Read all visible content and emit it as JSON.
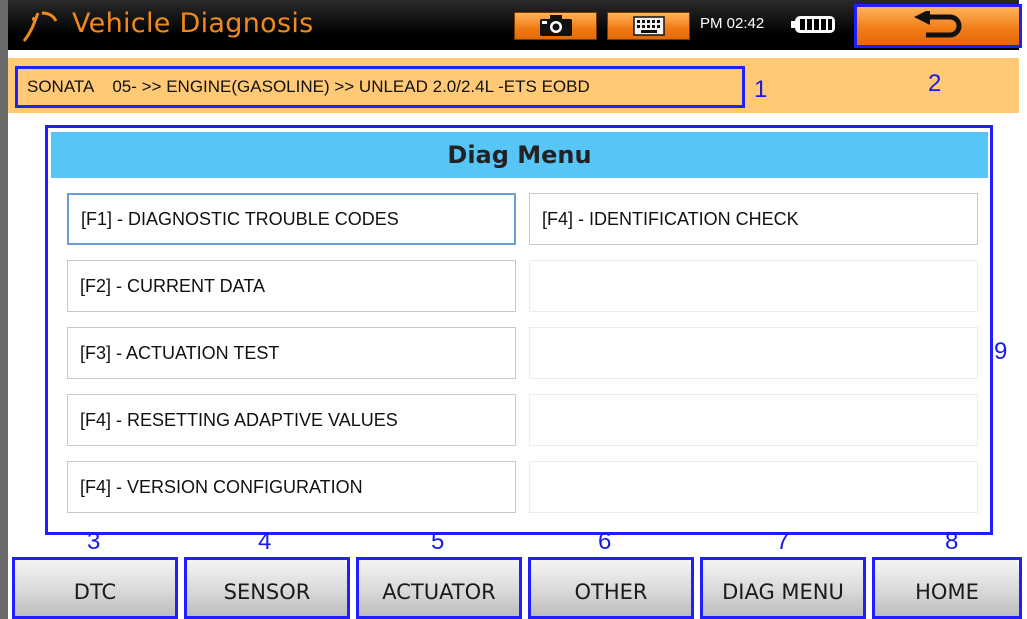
{
  "titlebar": {
    "title": "Vehicle Diagnosis",
    "time": "PM 02:42",
    "icons": {
      "logo": "app-logo-icon",
      "camera": "camera-icon",
      "keyboard": "keyboard-icon",
      "battery": "battery-icon",
      "back": "back-arrow-icon"
    }
  },
  "breadcrumb": {
    "text": "SONATA    05- >> ENGINE(GASOLINE) >> UNLEAD 2.0/2.4L -ETS EOBD"
  },
  "annotations": {
    "n1": "1",
    "n2": "2",
    "n3": "3",
    "n4": "4",
    "n5": "5",
    "n6": "6",
    "n7": "7",
    "n8": "8",
    "n9": "9"
  },
  "menu": {
    "title": "Diag Menu",
    "left": [
      "[F1] - DIAGNOSTIC TROUBLE CODES",
      "[F2] - CURRENT DATA",
      "[F3] - ACTUATION TEST",
      "[F4] - RESETTING ADAPTIVE VALUES",
      "[F4] - VERSION CONFIGURATION"
    ],
    "right": [
      "[F4] - IDENTIFICATION CHECK",
      "",
      "",
      "",
      ""
    ],
    "selected_index": 0
  },
  "bottom_buttons": [
    "DTC",
    "SENSOR",
    "ACTUATOR",
    "OTHER",
    "DIAG MENU",
    "HOME"
  ],
  "colors": {
    "accent_orange": "#f07a14",
    "annotation_blue": "#2020ff",
    "header_blue": "#57c5f5",
    "breadcrumb_bg": "#ffc976"
  }
}
